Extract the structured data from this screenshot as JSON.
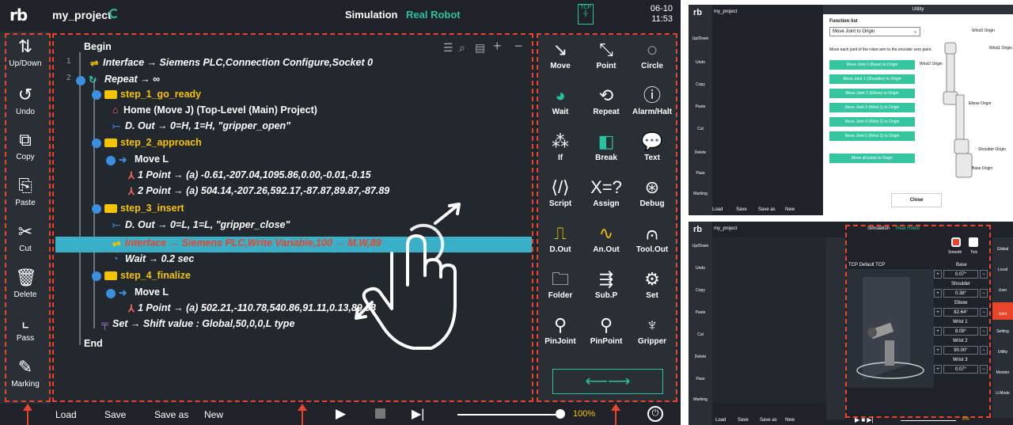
{
  "header": {
    "logo": "rb",
    "project_name": "my_project",
    "tab_simulation": "Simulation",
    "tab_real_robot": "Real Robot",
    "tcp_label": "TCP",
    "date": "06-10",
    "time": "11:53"
  },
  "left_toolbar": [
    {
      "label": "Up/Down",
      "icon": "up-down-arrows-icon"
    },
    {
      "label": "Undo",
      "icon": "undo-icon"
    },
    {
      "label": "Copy",
      "icon": "copy-icon"
    },
    {
      "label": "Paste",
      "icon": "paste-icon"
    },
    {
      "label": "Cut",
      "icon": "scissors-icon"
    },
    {
      "label": "Delete",
      "icon": "trash-icon"
    },
    {
      "label": "Pass",
      "icon": "pass-icon"
    },
    {
      "label": "Marking",
      "icon": "pencil-icon"
    }
  ],
  "program": {
    "begin": "Begin",
    "end": "End",
    "lines": [
      {
        "num": "1",
        "text": "Interface → Siemens PLC,Connection Configure,Socket 0"
      },
      {
        "num": "2",
        "text": "Repeat → ∞"
      },
      {
        "num": "",
        "text": "step_1_go_ready"
      },
      {
        "num": "",
        "text": "Home (Move J) (Top-Level (Main) Project)"
      },
      {
        "num": "",
        "text": "D. Out → 0=H, 1=H, \"gripper_open\""
      },
      {
        "num": "",
        "text": "step_2_approach"
      },
      {
        "num": "",
        "text": "Move L"
      },
      {
        "num": "",
        "text": "1 Point → (a) -0.61,-207.04,1095.86,0.00,-0.01,-0.15"
      },
      {
        "num": "",
        "text": "2 Point → (a) 504.14,-207.26,592.17,-87.87,89.87,-87.89"
      },
      {
        "num": "",
        "text": "step_3_insert"
      },
      {
        "num": "",
        "text": "D. Out → 0=L, 1=L, \"gripper_close\""
      },
      {
        "num": "",
        "text": "Interface → Siemens PLC,Write Variable,100 → M.W,89"
      },
      {
        "num": "",
        "text": "Wait → 0.2 sec"
      },
      {
        "num": "",
        "text": "step_4_finalize"
      },
      {
        "num": "",
        "text": "Move L"
      },
      {
        "num": "",
        "text": "1 Point → (a) 502.21,-110.78,540.86,91.11,0.13,89.98"
      },
      {
        "num": "",
        "text": "Set → Shift value : Global,50,0,0,L type"
      }
    ]
  },
  "right_toolbar": [
    {
      "label": "Move",
      "icon": "move-arrow-icon"
    },
    {
      "label": "Point",
      "icon": "point-icon"
    },
    {
      "label": "Circle",
      "icon": "circle-icon"
    },
    {
      "label": "Wait",
      "icon": "wait-icon"
    },
    {
      "label": "Repeat",
      "icon": "repeat-icon"
    },
    {
      "label": "Alarm/Halt",
      "icon": "alarm-icon"
    },
    {
      "label": "If",
      "icon": "if-icon"
    },
    {
      "label": "Break",
      "icon": "break-icon"
    },
    {
      "label": "Text",
      "icon": "text-bubble-icon"
    },
    {
      "label": "Script",
      "icon": "script-icon"
    },
    {
      "label": "Assign",
      "icon": "assign-icon"
    },
    {
      "label": "Debug",
      "icon": "debug-icon"
    },
    {
      "label": "D.Out",
      "icon": "digital-out-icon"
    },
    {
      "label": "An.Out",
      "icon": "analog-out-icon"
    },
    {
      "label": "Tool.Out",
      "icon": "tool-out-icon"
    },
    {
      "label": "Folder",
      "icon": "folder-icon"
    },
    {
      "label": "Sub.P",
      "icon": "sub-program-icon"
    },
    {
      "label": "Set",
      "icon": "set-gear-icon"
    },
    {
      "label": "PinJoint",
      "icon": "pin-joint-icon"
    },
    {
      "label": "PinPoint",
      "icon": "pin-point-icon"
    },
    {
      "label": "Gripper",
      "icon": "gripper-icon"
    }
  ],
  "bottom": {
    "load": "Load",
    "save": "Save",
    "save_as": "Save as",
    "new": "New",
    "speed": "100%"
  },
  "colors": {
    "accent": "#27c2a0",
    "highlight_row": "#3ab0c8",
    "annotation": "#e8452c",
    "folder": "#f5c400"
  },
  "utility": {
    "title": "Utility",
    "function_list_label": "Function list",
    "selected_function": "Move Joint to Origin",
    "description": "Move each joint of the robot arm to the encoder zero point.",
    "buttons": [
      "Move Joint 0 (Base) to Origin",
      "Move Joint 1 (Shoulder) to Origin",
      "Move Joint 2 (Elbow) to Origin",
      "Move Joint 3 (Wrist 1) to Origin",
      "Move Joint 4 (Wrist 2) to Origin",
      "Move Joint 5 (Wrist 3) to Origin",
      "Move all joints to Origin"
    ],
    "close": "Close",
    "callouts": [
      "Wrist3 Origin",
      "Wrist1 Origin",
      "Wrist2 Origin",
      "Elbow Origin",
      "Shoulder Origin",
      "Base Origin"
    ]
  },
  "jog": {
    "tcp": "TCP",
    "tcp_value": "Default TCP",
    "smooth": "Smooth",
    "tick": "Tick",
    "joints": [
      {
        "name": "Base",
        "value": "0.07°"
      },
      {
        "name": "Shoulder",
        "value": "0.38°"
      },
      {
        "name": "Elbow",
        "value": "82.64°"
      },
      {
        "name": "Wrist 1",
        "value": "8.09°"
      },
      {
        "name": "Wrist 2",
        "value": "90.00°"
      },
      {
        "name": "Wrist 3",
        "value": "0.07°"
      }
    ],
    "side_menu": [
      "Global",
      "Local",
      "User",
      "Joint",
      "Setting",
      "Utility",
      "Monitor",
      "U.Mode"
    ],
    "speed": "0%"
  }
}
